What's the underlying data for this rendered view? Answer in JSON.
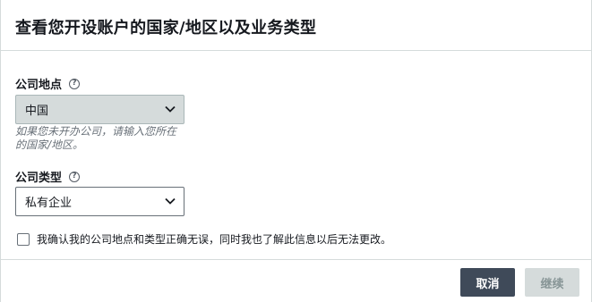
{
  "dialog": {
    "title": "查看您开设账户的国家/地区以及业务类型"
  },
  "location": {
    "label": "公司地点",
    "help": "?",
    "selected": "中国",
    "hint": "如果您未开办公司，请输入您所在的国家/地区。"
  },
  "company_type": {
    "label": "公司类型",
    "help": "?",
    "selected": "私有企业"
  },
  "confirm": {
    "text": "我确认我的公司地点和类型正确无误，同时我也了解此信息以后无法更改。"
  },
  "buttons": {
    "cancel": "取消",
    "continue": "继续"
  }
}
